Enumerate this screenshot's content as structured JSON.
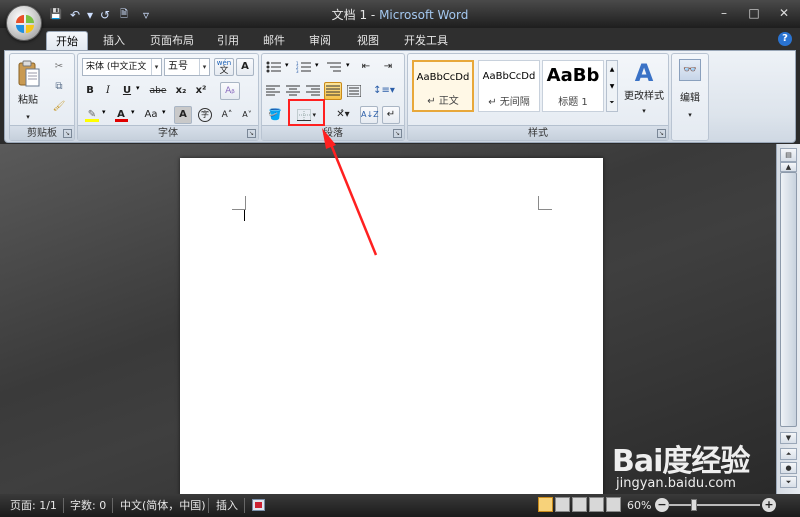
{
  "window": {
    "doc_title": "文档 1",
    "separator": " - ",
    "app_title": "Microsoft Word",
    "minimize": "–",
    "maximize": "□",
    "close": "✕"
  },
  "quick_access": {
    "save": "💾",
    "undo": "↶",
    "undo_dd": "▾",
    "redo": "↺",
    "print_preview": "🗎",
    "customize": "▿"
  },
  "tabs": [
    "开始",
    "插入",
    "页面布局",
    "引用",
    "邮件",
    "审阅",
    "视图",
    "开发工具"
  ],
  "active_tab": "开始",
  "help": "?",
  "clipboard": {
    "paste_label": "粘贴",
    "group_label": "剪贴板"
  },
  "font": {
    "family": "宋体 (中文正文",
    "size": "五号",
    "bold": "B",
    "italic": "I",
    "underline": "U",
    "strikethrough": "abe",
    "subscript": "x₂",
    "superscript": "x²",
    "font_color": "A",
    "change_case": "Aa",
    "char_shading": "A",
    "enclose": "字",
    "grow": "A˄",
    "shrink": "A˅",
    "phonetic": "wén",
    "group_label": "字体"
  },
  "paragraph": {
    "group_label": "段落"
  },
  "styles": {
    "items": [
      {
        "sample": "AaBbCcDd",
        "name": "↵ 正文"
      },
      {
        "sample": "AaBbCcDd",
        "name": "↵ 无间隔"
      },
      {
        "sample": "AaBb",
        "name": "标题 1"
      }
    ],
    "change_styles": "更改样式",
    "group_label": "样式"
  },
  "editing": {
    "label": "编辑"
  },
  "status": {
    "page": "页面: 1/1",
    "words": "字数: 0",
    "language": "中文(简体，中国)",
    "insert_mode": "插入",
    "zoom": "60%",
    "zoom_level": 60,
    "zoom_out": "−",
    "zoom_in": "+"
  },
  "watermark": {
    "brand": "Bai度经验",
    "url": "jingyan.baidu.com"
  },
  "colors": {
    "annotation": "#ff2020",
    "title_app": "#a4c8f0",
    "selected_style": "#e8a83a"
  }
}
